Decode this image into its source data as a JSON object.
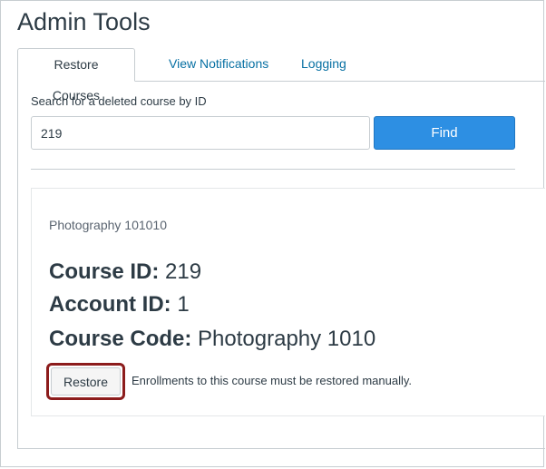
{
  "page": {
    "title": "Admin Tools"
  },
  "tabs": [
    {
      "label": "Restore Courses",
      "active": true
    },
    {
      "label": "View Notifications",
      "active": false
    },
    {
      "label": "Logging",
      "active": false
    }
  ],
  "search": {
    "label": "Search for a deleted course by ID",
    "value": "219",
    "find_label": "Find"
  },
  "result": {
    "course_name": "Photography 101010",
    "course_id": {
      "key": "Course ID:",
      "value": "219"
    },
    "account_id": {
      "key": "Account ID:",
      "value": "1"
    },
    "course_code": {
      "key": "Course Code:",
      "value": "Photography 1010"
    },
    "restore_label": "Restore",
    "restore_note": "Enrollments to this course must be restored manually."
  },
  "colors": {
    "primary": "#2d8fe3",
    "link": "#0770a3",
    "highlight_outline": "#8c1c1c",
    "text": "#2d3b45"
  }
}
